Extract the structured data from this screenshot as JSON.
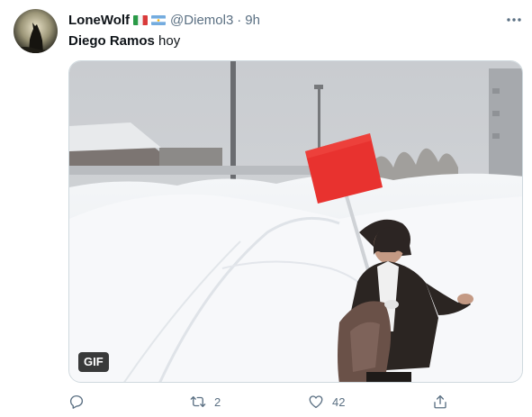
{
  "tweet": {
    "display_name": "LoneWolf",
    "flags": [
      "italy-flag",
      "argentina-flag"
    ],
    "handle": "@Diemol3",
    "separator": "·",
    "time": "9h",
    "text_bold": "Diego Ramos",
    "text_rest": " hoy",
    "media": {
      "badge": "GIF",
      "sign_color": "#e8322f"
    },
    "actions": {
      "reply": {
        "icon": "reply-icon",
        "count": ""
      },
      "retweet": {
        "icon": "retweet-icon",
        "count": "2"
      },
      "like": {
        "icon": "heart-icon",
        "count": "42"
      },
      "share": {
        "icon": "share-icon",
        "count": ""
      }
    }
  },
  "colors": {
    "text": "#0f1419",
    "secondary": "#5b7083",
    "border": "#cfd9de"
  }
}
